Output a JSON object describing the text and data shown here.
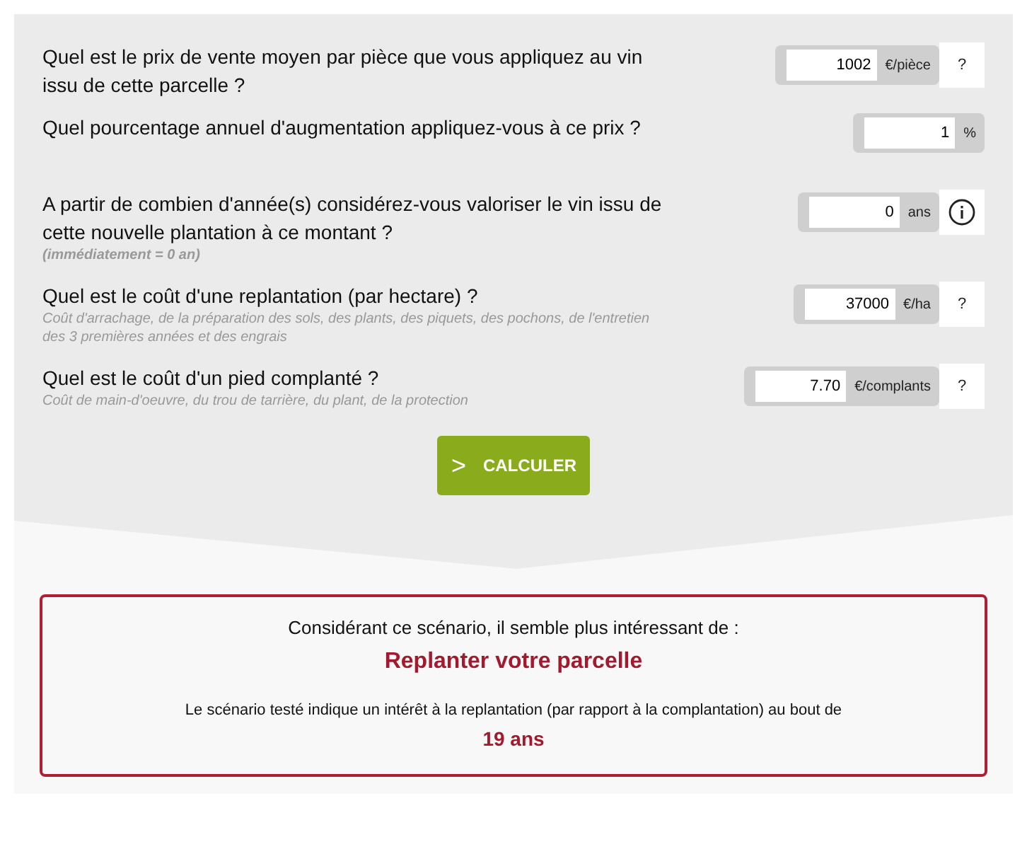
{
  "questions": [
    {
      "label": "Quel est le prix de vente moyen par pièce que vous appliquez au vin issu de cette parcelle ?",
      "value": "1002",
      "unit": "€/pièce",
      "help": {
        "kind": "question",
        "text": "?"
      }
    },
    {
      "label": "Quel pourcentage annuel d'augmentation appliquez-vous à ce prix ?",
      "value": "1",
      "unit": "%"
    },
    {
      "label": "A partir de combien d'année(s) considérez-vous valoriser le vin issu de cette nouvelle plantation à ce montant ?",
      "hint": "(immédiatement = 0 an)",
      "hint_bold": true,
      "value": "0",
      "unit": "ans",
      "help": {
        "kind": "info"
      }
    },
    {
      "label": "Quel est le coût d'une replantation (par hectare) ?",
      "hint": "Coût d'arrachage, de la préparation des sols, des plants, des piquets, des pochons, de l'entretien des 3 premières années et des engrais",
      "value": "37000",
      "unit": "€/ha",
      "help": {
        "kind": "question",
        "text": "?"
      }
    },
    {
      "label": "Quel est le coût d'un pied complanté ?",
      "hint": "Coût de main-d'oeuvre, du trou de tarrière, du plant, de la protection",
      "value": "7.70",
      "unit": "€/complants",
      "help": {
        "kind": "question",
        "text": "?"
      }
    }
  ],
  "button": {
    "icon": ">",
    "label": "CALCULER"
  },
  "result": {
    "intro": "Considérant ce scénario, il semble plus intéressant de :",
    "decision": "Replanter votre parcelle",
    "detail": "Le scénario testé indique un intérêt à la replantation (par rapport à la complantation) au bout de",
    "years": "19 ans"
  }
}
